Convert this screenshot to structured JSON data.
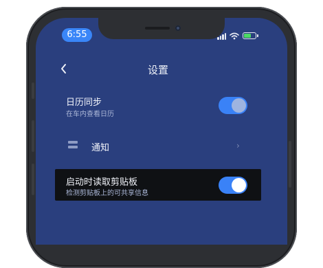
{
  "status_bar": {
    "time": "6:55"
  },
  "header": {
    "back_icon": "chevron-left-icon",
    "title": "设置"
  },
  "calendar_sync": {
    "title": "日历同步",
    "subtitle": "在车内查看日历",
    "toggle_on": true
  },
  "notification": {
    "icon": "list-icon",
    "label": "通知",
    "chevron": "›"
  },
  "clipboard": {
    "title": "启动时读取剪贴板",
    "subtitle": "检测剪贴板上的可共享信息",
    "toggle_on": true
  },
  "colors": {
    "screen_bg": "#2a3f7e",
    "accent": "#3a82f7",
    "highlight_bg": "#0f1114"
  }
}
